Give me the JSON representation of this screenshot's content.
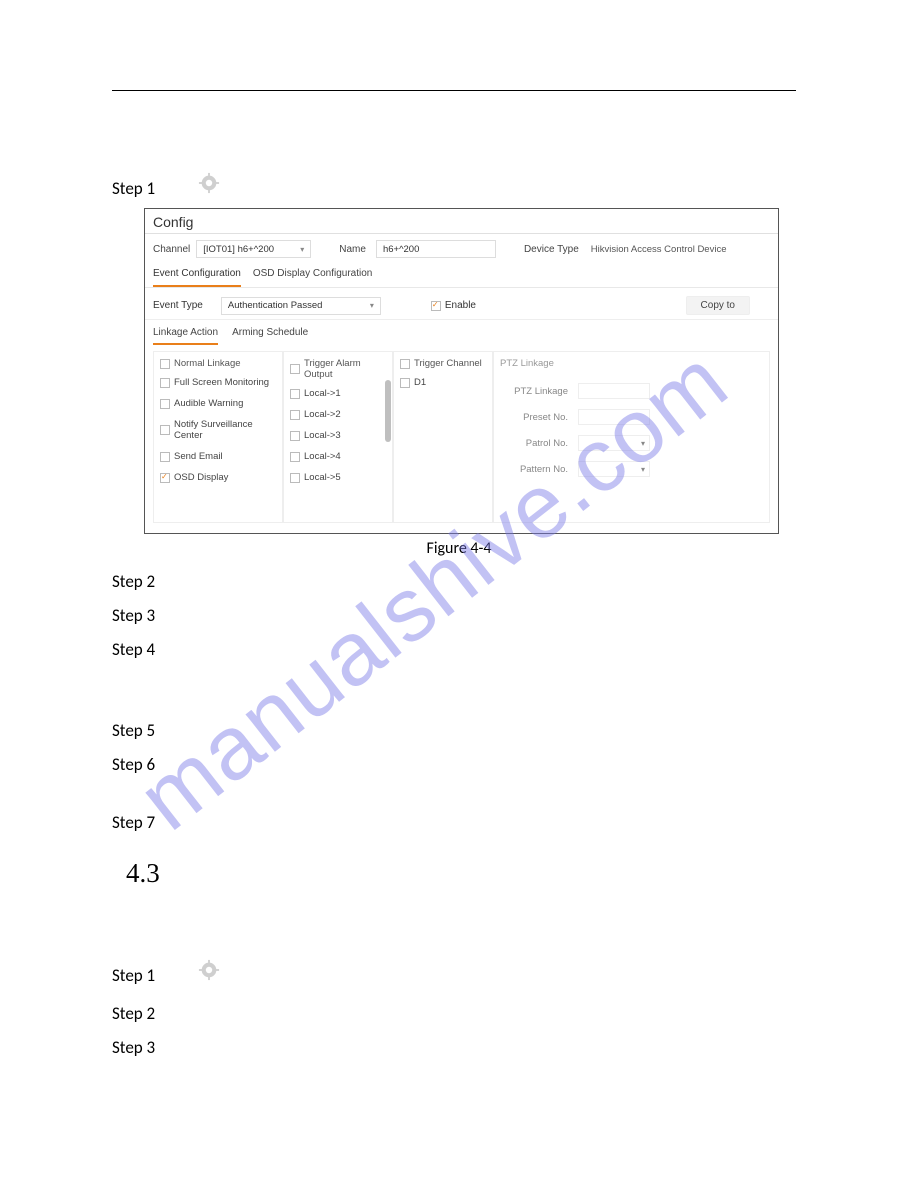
{
  "steps_a": [
    "Step 1",
    "Step 2",
    "Step 3",
    "Step 4",
    "Step 5",
    "Step 6",
    "Step 7"
  ],
  "section": "4.3",
  "steps_b": [
    "Step 1",
    "Step 2",
    "Step 3"
  ],
  "figure_caption": "Figure 4-4",
  "watermark": "manualshive.com",
  "panel": {
    "title": "Config",
    "channel_label": "Channel",
    "channel_value": "[IOT01] h6+^200",
    "name_label": "Name",
    "name_value": "h6+^200",
    "device_type_label": "Device Type",
    "device_type_value": "Hikvision Access Control Device",
    "tabs": [
      "Event Configuration",
      "OSD Display Configuration"
    ],
    "event_type_label": "Event Type",
    "event_type_value": "Authentication Passed",
    "enable_label": "Enable",
    "copy_to": "Copy to",
    "subtabs": [
      "Linkage Action",
      "Arming Schedule"
    ],
    "cols": {
      "normal_linkage": "Normal Linkage",
      "trigger_alarm_output": "Trigger Alarm Output",
      "trigger_channel": "Trigger Channel",
      "ptz_linkage": "PTZ Linkage"
    },
    "normal_opts": [
      "Full Screen Monitoring",
      "Audible Warning",
      "Notify Surveillance Center",
      "Send Email",
      "OSD Display"
    ],
    "local_opts": [
      "Local->1",
      "Local->2",
      "Local->3",
      "Local->4",
      "Local->5"
    ],
    "channel_opts": [
      "D1"
    ],
    "ptz": {
      "ptz_linkage": "PTZ Linkage",
      "preset_no": "Preset No.",
      "patrol_no": "Patrol No.",
      "pattern_no": "Pattern No."
    }
  }
}
